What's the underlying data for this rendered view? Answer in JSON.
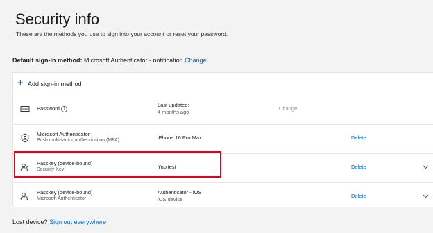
{
  "header": {
    "title": "Security info",
    "subtitle": "These are the methods you use to sign into your account or reset your password."
  },
  "default_method": {
    "label": "Default sign-in method:",
    "value": "Microsoft Authenticator - notification",
    "change_link": "Change"
  },
  "add_method": {
    "label": "Add sign-in method"
  },
  "methods": [
    {
      "name": "Password",
      "sub": "",
      "detail1": "Last updated:",
      "detail2": "4 months ago",
      "action": "Change",
      "icon": "password-icon"
    },
    {
      "name": "Microsoft Authenticator",
      "sub": "Push multi-factor authentication (MFA)",
      "detail1": "iPhone 16 Pro Max",
      "detail2": "",
      "action": "Delete",
      "icon": "authenticator-icon"
    },
    {
      "name": "Passkey (device-bound)",
      "sub": "Security Key",
      "detail1": "Yubitest",
      "detail2": "",
      "action": "Delete",
      "icon": "passkey-icon"
    },
    {
      "name": "Passkey (device-bound)",
      "sub": "Microsoft Authenticator",
      "detail1": "Authenticator - iOS",
      "detail2": "iOS device",
      "action": "Delete",
      "icon": "passkey-icon"
    }
  ],
  "footer": {
    "lost_label": "Lost device?",
    "sign_out_link": "Sign out everywhere"
  },
  "colors": {
    "link": "#0067b8",
    "highlight": "#e0001b",
    "background": "#f3f3f3"
  }
}
